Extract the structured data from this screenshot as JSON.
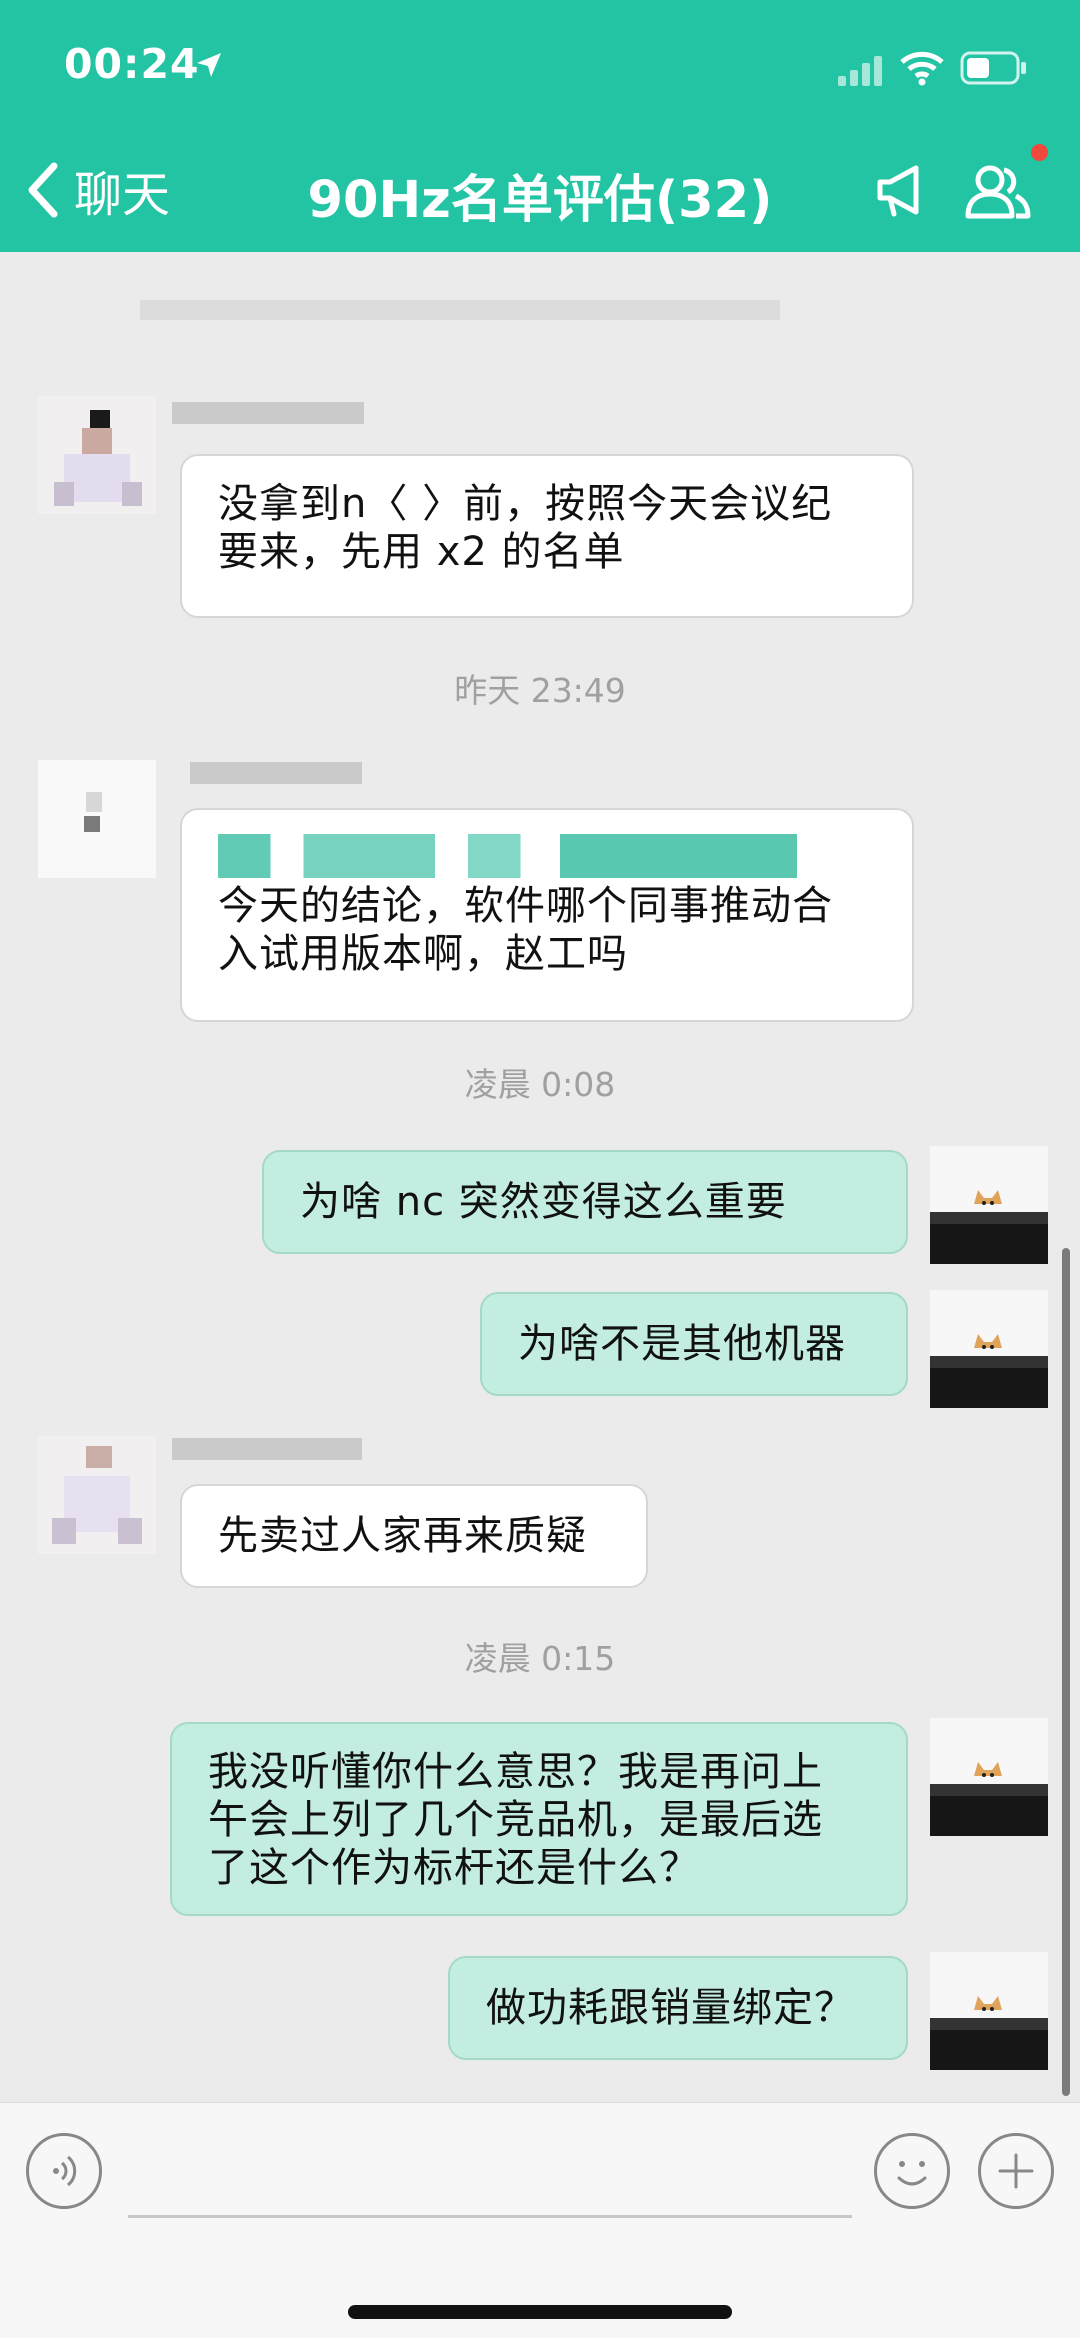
{
  "status_bar": {
    "time": "00:24"
  },
  "nav": {
    "back_label": "聊天",
    "title": "90Hz名单评估(32)"
  },
  "messages": [
    {
      "text": "没拿到n〈   〉前，按照今天会议纪\n要来，先用 x2 的名单"
    },
    {
      "text": "今天的结论，软件哪个同事推动合\n入试用版本啊，赵工吗"
    },
    {
      "text": "为啥 nc   突然变得这么重要"
    },
    {
      "text": "为啥不是其他机器"
    },
    {
      "text": "先卖过人家再来质疑"
    },
    {
      "text": "我没听懂你什么意思？我是再问上\n午会上列了几个竞品机，是最后选\n了这个作为标杆还是什么？"
    },
    {
      "text": "做功耗跟销量绑定？"
    }
  ],
  "timestamps": [
    "昨天 23:49",
    "凌晨 0:08",
    "凌晨 0:15"
  ],
  "colors": {
    "header": "#22c4a4",
    "bubble_right": "#c4ede2",
    "bubble_left": "#ffffff",
    "badge": "#f04a3c"
  }
}
